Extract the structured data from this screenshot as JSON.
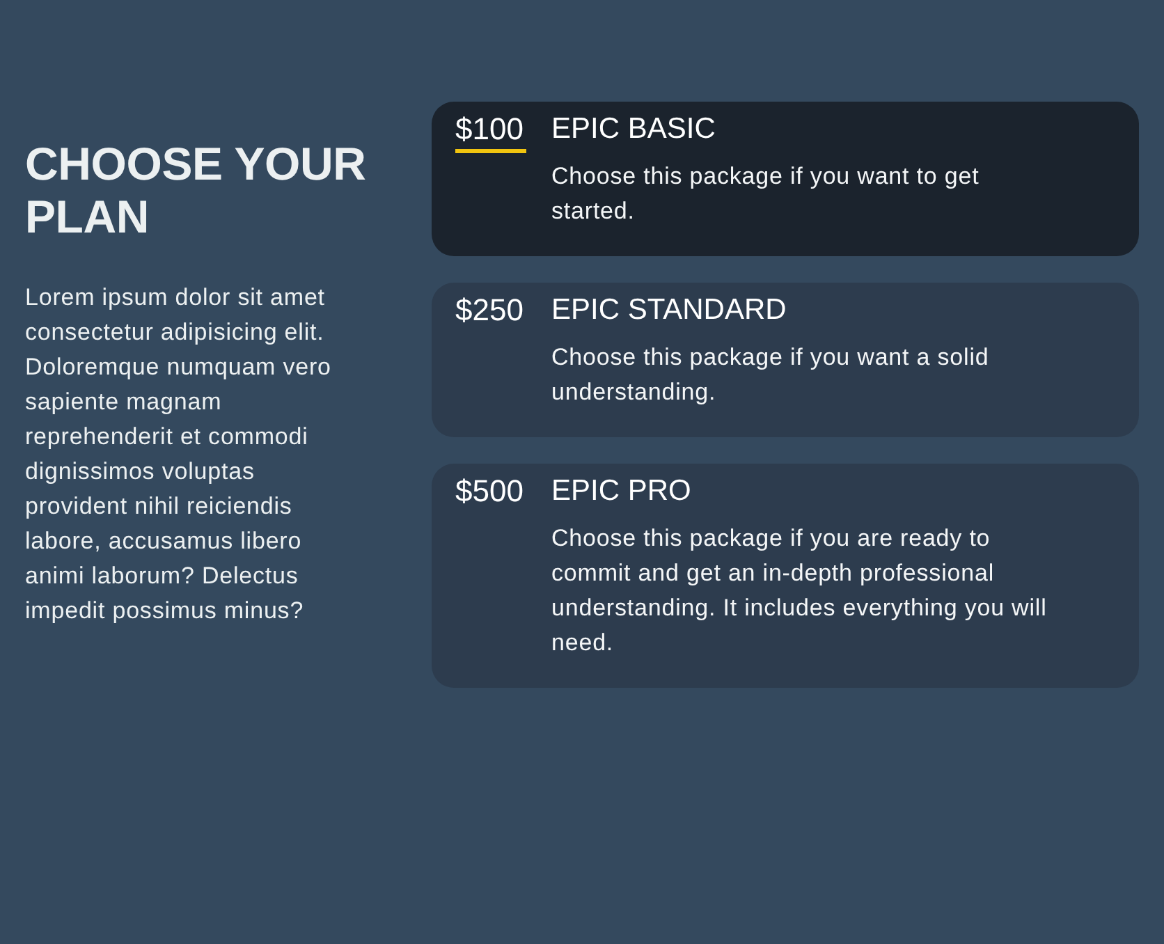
{
  "intro": {
    "title": "CHOOSE YOUR PLAN",
    "text": "Lorem ipsum dolor sit amet consectetur adipisicing elit. Doloremque numquam vero sapiente magnam reprehenderit et commodi dignissimos voluptas provident nihil reiciendis labore, accusamus libero animi laborum? Delectus impedit possimus minus?"
  },
  "plans": [
    {
      "price": "$100",
      "name": "EPIC BASIC",
      "description": "Choose this package if you want to get started.",
      "selected": true
    },
    {
      "price": "$250",
      "name": "EPIC STANDARD",
      "description": "Choose this package if you want a solid understanding.",
      "selected": false
    },
    {
      "price": "$500",
      "name": "EPIC PRO",
      "description": "Choose this package if you are ready to commit and get an in-depth professional understanding. It includes everything you will need.",
      "selected": false
    }
  ]
}
